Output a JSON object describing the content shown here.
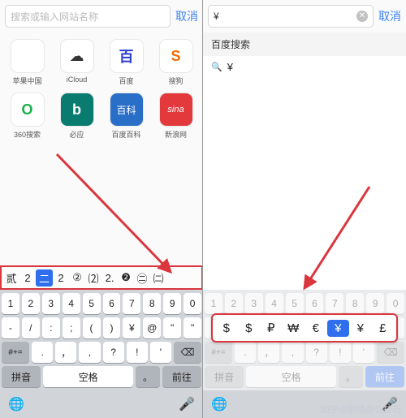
{
  "left": {
    "search_placeholder": "搜索或输入网站名称",
    "cancel": "取消",
    "bookmarks": [
      {
        "icon": "",
        "label": "苹果中国"
      },
      {
        "icon": "☁",
        "label": "iCloud"
      },
      {
        "icon": "百",
        "label": "百度"
      },
      {
        "icon": "S",
        "label": "搜狗"
      },
      {
        "icon": "O",
        "label": "360搜索"
      },
      {
        "icon": "b",
        "label": "必应"
      },
      {
        "icon": "百科",
        "label": "百度百科"
      },
      {
        "icon": "sina",
        "label": "新浪网"
      }
    ],
    "candidates": [
      "贰",
      "2",
      "二",
      "2",
      "②",
      "⑵",
      "2.",
      "❷",
      "㊁",
      "㈡"
    ],
    "candidate_selected_index": 2,
    "num_row": [
      "1",
      "2",
      "3",
      "4",
      "5",
      "6",
      "7",
      "8",
      "9",
      "0"
    ],
    "sym_row1": [
      "-",
      "/",
      ":",
      ";",
      "(",
      ")",
      "¥",
      "@",
      "\"",
      "\""
    ],
    "sym_row2_start": "#+=",
    "sym_row2": [
      ".",
      "，",
      ",",
      "?",
      "!",
      "'"
    ],
    "bottom": {
      "mode": "拼音",
      "space": "空格",
      "dot": "。",
      "go": "前往"
    }
  },
  "right": {
    "search_value": "¥",
    "cancel": "取消",
    "suggest_header": "百度搜索",
    "suggest_item": "¥",
    "currency_popup": [
      "$",
      "$",
      "₽",
      "₩",
      "€",
      "¥",
      "¥",
      "£"
    ],
    "currency_selected_index": 5,
    "bottom": {
      "mode": "拼音",
      "space": "空格",
      "dot": "。",
      "go": "前往"
    }
  },
  "watermark": "知乎@职场办公技巧"
}
